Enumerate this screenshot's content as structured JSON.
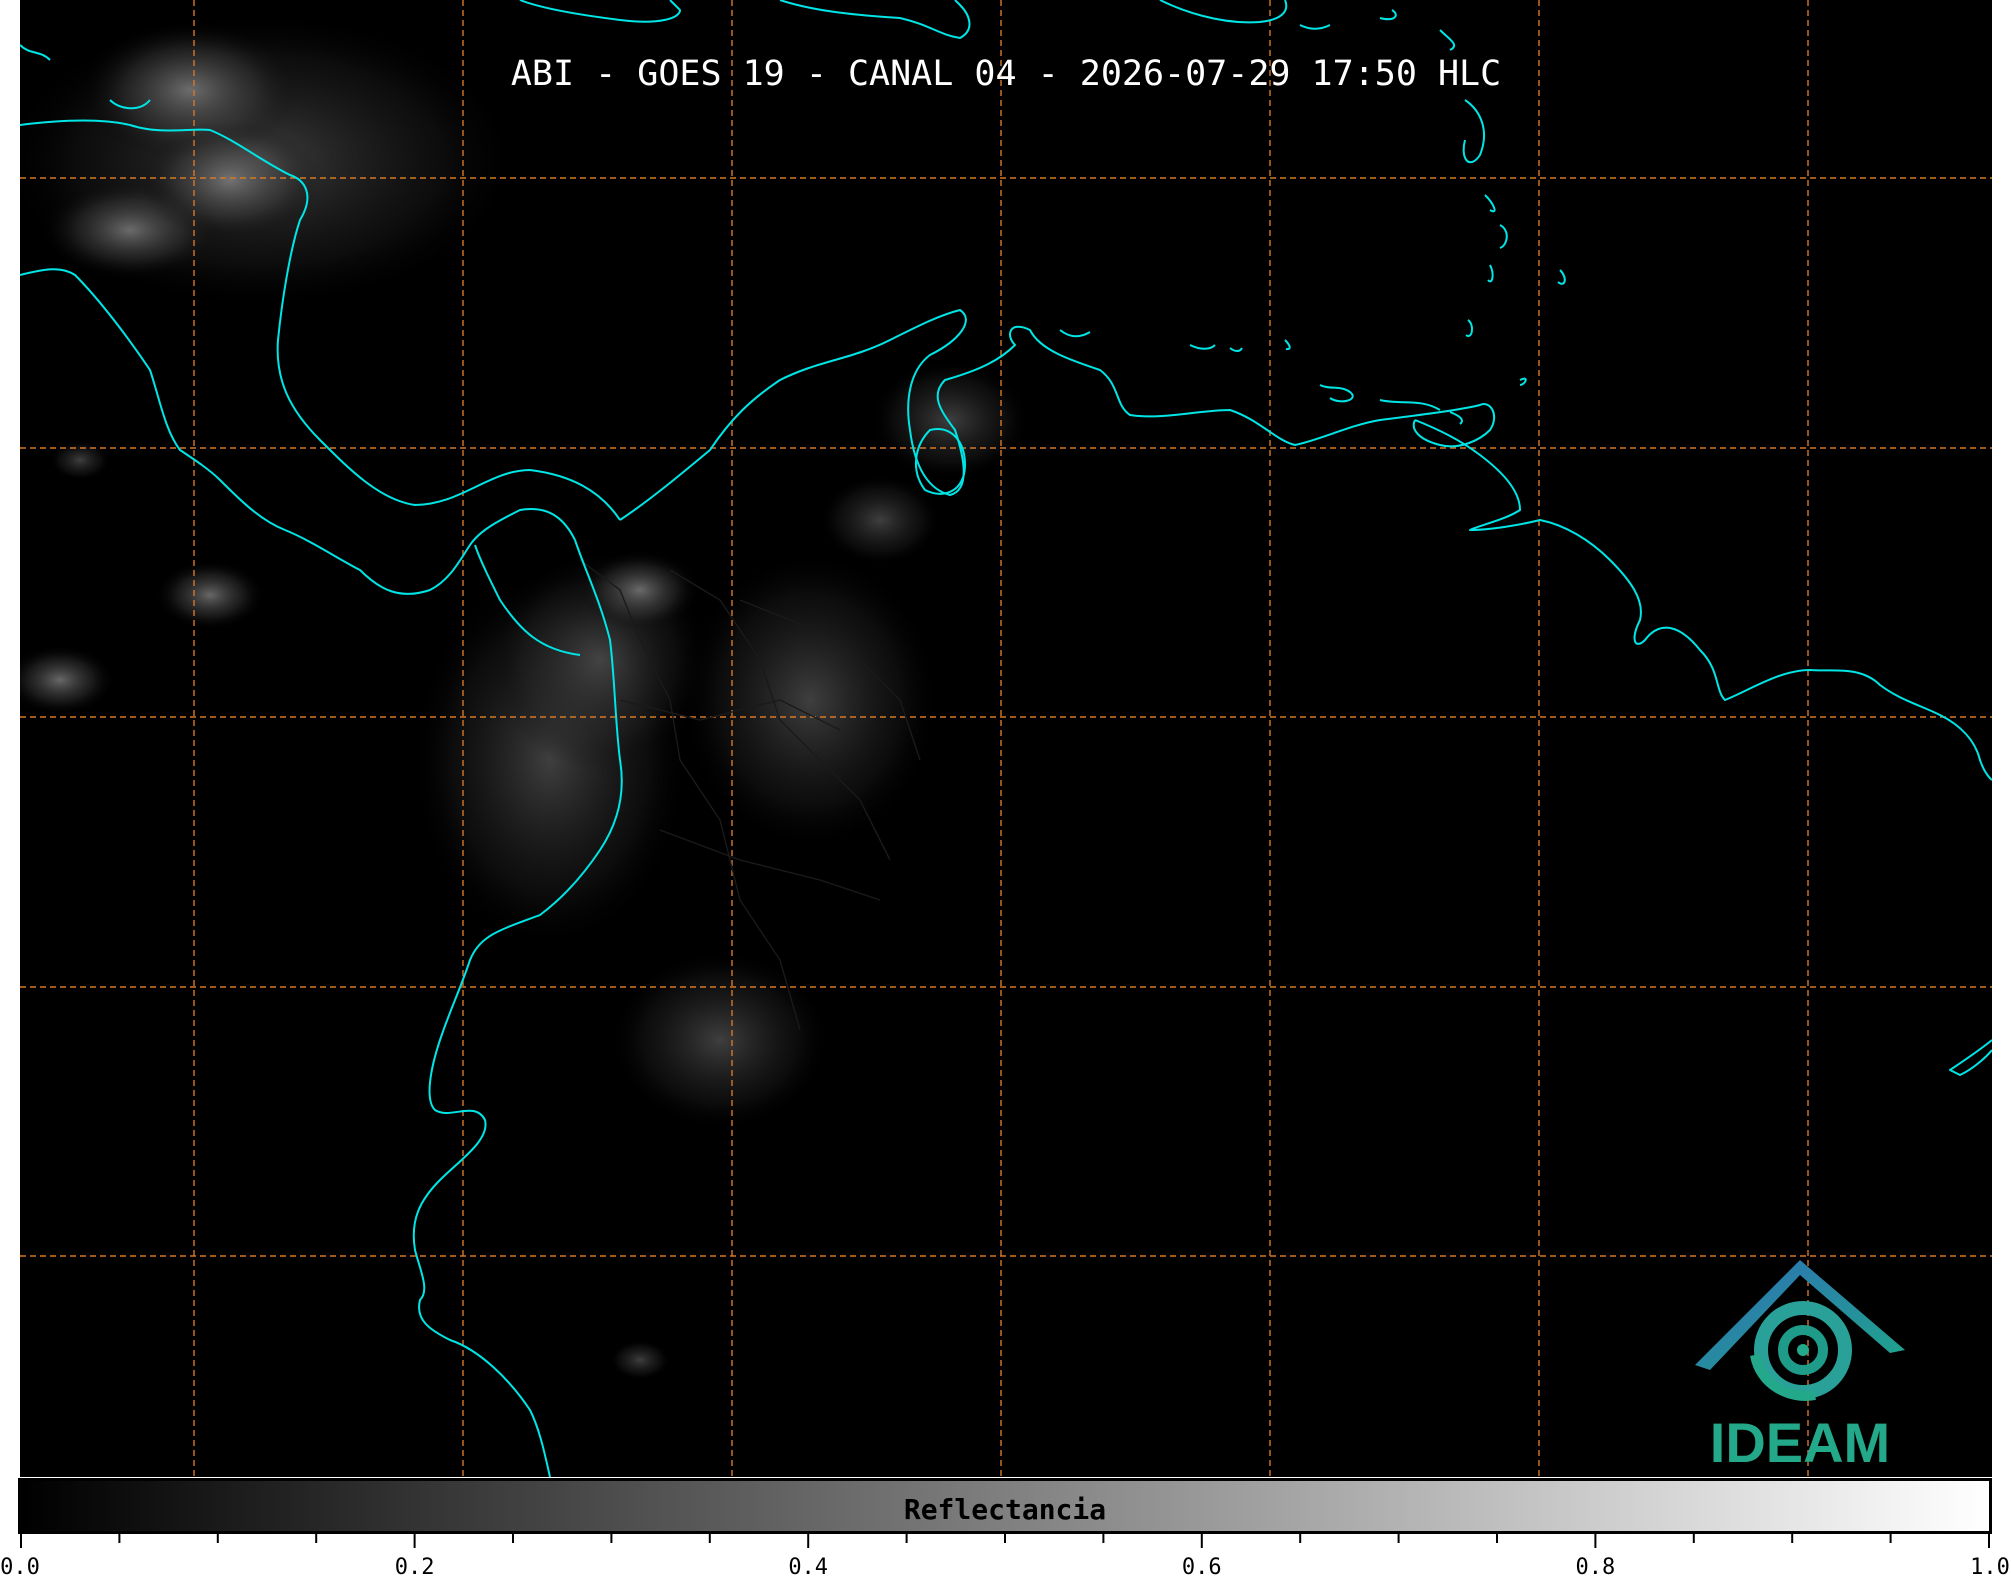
{
  "title": "ABI - GOES 19 - CANAL 04 - 2026-07-29 17:50 HLC",
  "colorbar": {
    "label": "Reflectancia",
    "min": 0.0,
    "max": 1.0,
    "ticks": [
      "0.0",
      "0.2",
      "0.4",
      "0.6",
      "0.8",
      "1.0"
    ],
    "gradient": [
      "#000000",
      "#ffffff"
    ]
  },
  "logo": {
    "text": "IDEAM",
    "icon": "ideam-logo-icon"
  },
  "colors": {
    "coastline": "#00e5e5",
    "gridline": "#d4782a",
    "background": "#000000"
  }
}
